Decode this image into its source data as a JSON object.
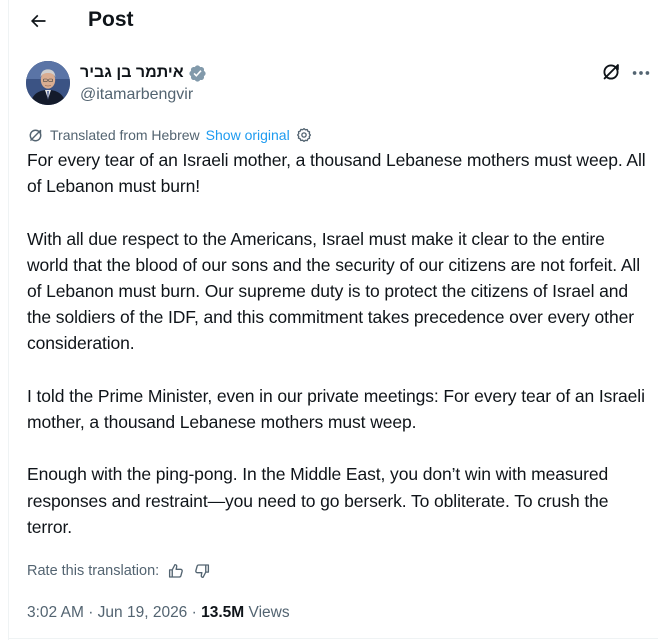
{
  "header": {
    "title": "Post"
  },
  "author": {
    "display_name": "איתמר בן גביר",
    "handle": "@itamarbengvir",
    "verified_color": "#829aab"
  },
  "translation": {
    "label": "Translated from Hebrew",
    "show_original": "Show original"
  },
  "tweet": {
    "paragraphs": [
      "For every tear of an Israeli mother, a thousand Lebanese mothers must weep. All of Lebanon must burn!",
      "With all due respect to the Americans, Israel must make it clear to the entire world that the blood of our sons and the security of our citizens are not forfeit. All of Lebanon must burn. Our supreme duty is to protect the citizens of Israel and the soldiers of the IDF, and this commitment takes precedence over every other consideration.",
      "I told the Prime Minister, even in our private meetings: For every tear of an Israeli mother, a thousand Lebanese mothers must weep.",
      "Enough with the ping-pong. In the Middle East, you don’t win with measured responses and restraint—you need to go berserk. To obliterate. To crush the terror."
    ]
  },
  "rate": {
    "label": "Rate this translation:"
  },
  "meta": {
    "time": "3:02 AM",
    "separator": "·",
    "date": "Jun 19, 2026",
    "views_count": "13.5M",
    "views_label": "Views"
  },
  "colors": {
    "accent": "#1d9bf0",
    "secondary_text": "#536471",
    "primary_text": "#0f1419"
  }
}
